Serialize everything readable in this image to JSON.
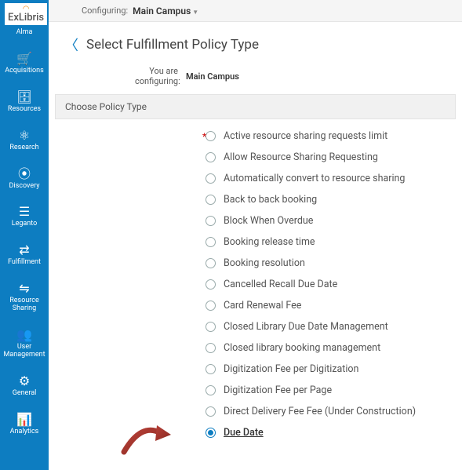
{
  "brand": "ExLibris",
  "topbar": {
    "configuring_label": "Configuring:",
    "configuring_value": "Main Campus"
  },
  "sidebar": {
    "items": [
      {
        "name": "alma",
        "label": "Alma",
        "icon": "✦"
      },
      {
        "name": "acquisitions",
        "label": "Acquisitions",
        "icon": "🛒"
      },
      {
        "name": "resources",
        "label": "Resources",
        "icon": "🗄"
      },
      {
        "name": "research",
        "label": "Research",
        "icon": "⚛"
      },
      {
        "name": "discovery",
        "label": "Discovery",
        "icon": "⦿"
      },
      {
        "name": "leganto",
        "label": "Leganto",
        "icon": "☰"
      },
      {
        "name": "fulfillment",
        "label": "Fulfillment",
        "icon": "⇄"
      },
      {
        "name": "resource-sharing",
        "label": "Resource\nSharing",
        "icon": "⇋"
      },
      {
        "name": "user-management",
        "label": "User\nManagement",
        "icon": "👥"
      },
      {
        "name": "general",
        "label": "General",
        "icon": "⚙"
      },
      {
        "name": "analytics",
        "label": "Analytics",
        "icon": "📊"
      }
    ]
  },
  "page": {
    "title": "Select Fulfillment Policy Type",
    "subhead_label": "You are configuring:",
    "subhead_value": "Main Campus",
    "section": "Choose Policy Type"
  },
  "policy_types": [
    {
      "label": "Active resource sharing requests limit",
      "selected": false
    },
    {
      "label": "Allow Resource Sharing Requesting",
      "selected": false
    },
    {
      "label": "Automatically convert to resource sharing",
      "selected": false
    },
    {
      "label": "Back to back booking",
      "selected": false
    },
    {
      "label": "Block When Overdue",
      "selected": false
    },
    {
      "label": "Booking release time",
      "selected": false
    },
    {
      "label": "Booking resolution",
      "selected": false
    },
    {
      "label": "Cancelled Recall Due Date",
      "selected": false
    },
    {
      "label": "Card Renewal Fee",
      "selected": false
    },
    {
      "label": "Closed Library Due Date Management",
      "selected": false
    },
    {
      "label": "Closed library booking management",
      "selected": false
    },
    {
      "label": "Digitization Fee per Digitization",
      "selected": false
    },
    {
      "label": "Digitization Fee per Page",
      "selected": false
    },
    {
      "label": "Direct Delivery Fee Fee (Under Construction)",
      "selected": false
    },
    {
      "label": "Due Date",
      "selected": true
    }
  ]
}
